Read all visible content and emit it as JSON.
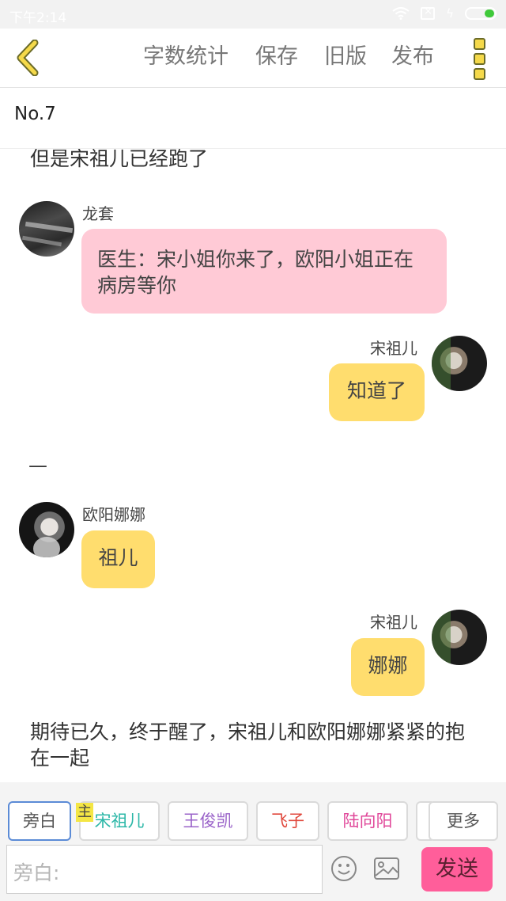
{
  "status": {
    "time": "下午2:14"
  },
  "toolbar": {
    "word_count": "字数统计",
    "save": "保存",
    "old_version": "旧版",
    "publish": "发布"
  },
  "chapter": {
    "title": "No.7"
  },
  "messages": {
    "narration_1": "但是宋祖儿已经跑了",
    "m1_name": "龙套",
    "m1_text": "医生：宋小姐你来了，欧阳小姐正在病房等你",
    "m2_name": "宋祖儿",
    "m2_text": "知道了",
    "dash": "—",
    "m3_name": "欧阳娜娜",
    "m3_text": "祖儿",
    "m4_name": "宋祖儿",
    "m4_text": "娜娜",
    "narration_2": "期待已久，终于醒了，宋祖儿和欧阳娜娜紧紧的抱在一起"
  },
  "roles": {
    "narrator": "旁白",
    "host_tag": "主",
    "r1": "宋祖儿",
    "r2": "王俊凯",
    "r3": "飞子",
    "r4": "陆向阳",
    "more": "更多"
  },
  "role_colors": {
    "r1": "#2bb7a7",
    "r2": "#9a63c9",
    "r3": "#e0483c",
    "r4": "#e0489a"
  },
  "input": {
    "placeholder": "旁白:",
    "send": "发送"
  }
}
